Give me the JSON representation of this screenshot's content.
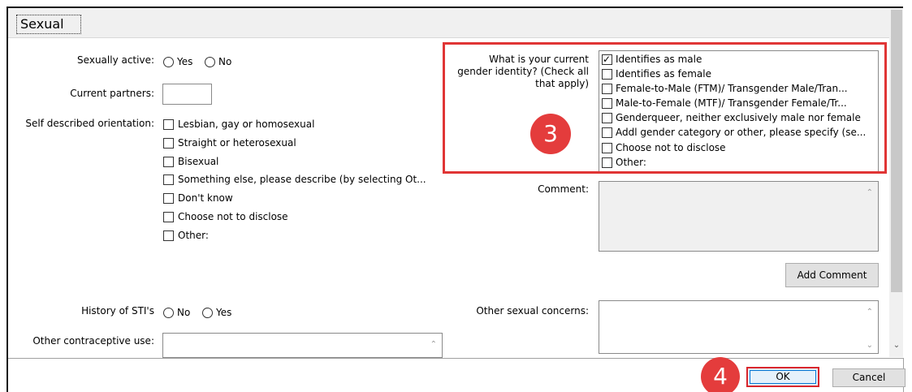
{
  "header": {
    "title": "Sexual"
  },
  "left_form": {
    "sexually_active": {
      "label": "Sexually active:",
      "options": [
        "Yes",
        "No"
      ]
    },
    "current_partners": {
      "label": "Current partners:",
      "value": ""
    },
    "orientation": {
      "label": "Self described orientation:",
      "options": [
        "Lesbian, gay or homosexual",
        "Straight or heterosexual",
        "Bisexual",
        "Something else, please describe (by selecting Ot...",
        "Don't know",
        "Choose not to disclose",
        "Other:"
      ]
    },
    "sti_history": {
      "label": "History of STI's",
      "options": [
        "No",
        "Yes"
      ]
    },
    "contraceptive": {
      "label": "Other contraceptive use:",
      "value": ""
    }
  },
  "right_form": {
    "gender_identity": {
      "label_lines": [
        "What is your current",
        "gender identity? (Check all",
        "that apply)"
      ],
      "options": [
        {
          "label": "Identifies as male",
          "checked": true
        },
        {
          "label": "Identifies as female",
          "checked": false
        },
        {
          "label": "Female-to-Male (FTM)/ Transgender Male/Tran...",
          "checked": false
        },
        {
          "label": "Male-to-Female (MTF)/ Transgender Female/Tr...",
          "checked": false
        },
        {
          "label": "Genderqueer, neither exclusively male nor female",
          "checked": false
        },
        {
          "label": "Addl gender category or other, please specify (se...",
          "checked": false
        },
        {
          "label": "Choose not to disclose",
          "checked": false
        },
        {
          "label": "Other:",
          "checked": false
        }
      ]
    },
    "comment": {
      "label": "Comment:",
      "value": ""
    },
    "add_comment_button": "Add Comment",
    "other_concerns": {
      "label": "Other sexual concerns:",
      "value": ""
    }
  },
  "footer": {
    "ok": "OK",
    "cancel": "Cancel"
  },
  "annotations": {
    "step3": "3",
    "step4": "4",
    "highlight_color": "#e03535"
  }
}
